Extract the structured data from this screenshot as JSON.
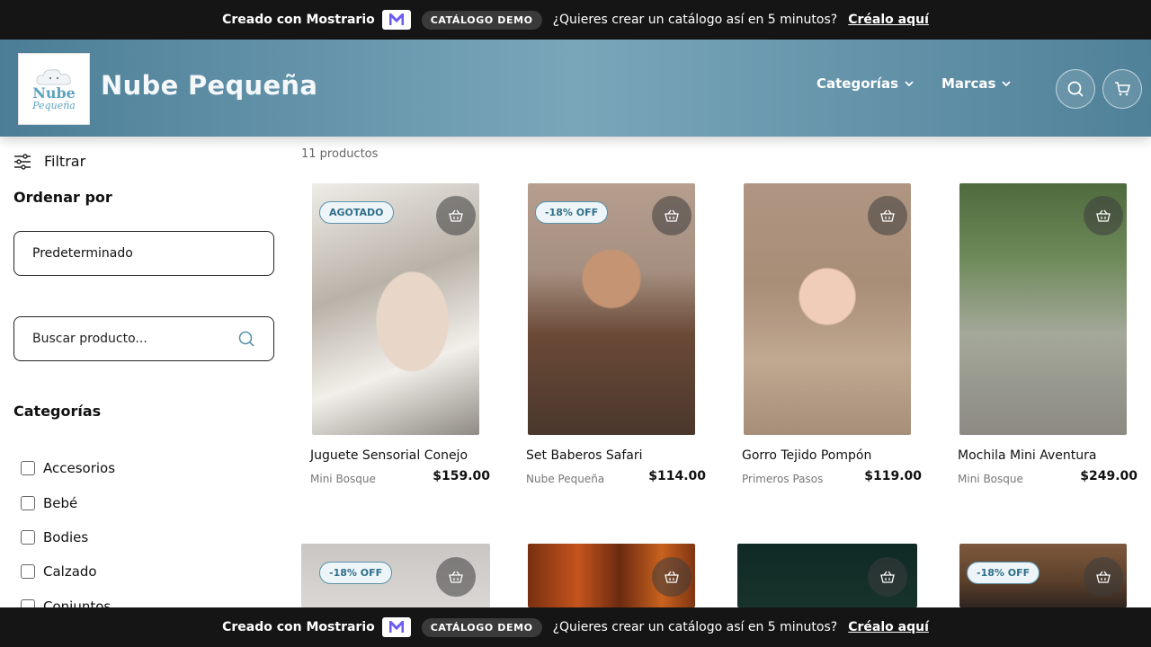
{
  "promo": {
    "created": "Creado con Mostrario",
    "demo_badge": "CATÁLOGO DEMO",
    "question": "¿Quieres crear un catálogo así en 5 minutos?",
    "cta": "Créalo aquí"
  },
  "header": {
    "logo_line1": "Nube",
    "logo_line2": "Pequeña",
    "brand_name": "Nube Pequeña",
    "nav": [
      "Categorías",
      "Marcas"
    ]
  },
  "sidebar": {
    "filter_label": "Filtrar",
    "sort_label": "Ordenar por",
    "sort_value": "Predeterminado",
    "search_placeholder": "Buscar producto...",
    "categories_title": "Categorías",
    "categories": [
      "Accesorios",
      "Bebé",
      "Bodies",
      "Calzado",
      "Conjuntos"
    ]
  },
  "catalog": {
    "count": "11 productos",
    "products": [
      {
        "name": "Juguete Sensorial Conejo",
        "brand": "Mini Bosque",
        "price": "$159.00",
        "badge": "AGOTADO"
      },
      {
        "name": "Set Baberos Safari",
        "brand": "Nube Pequeña",
        "price": "$114.00",
        "badge": "-18% OFF"
      },
      {
        "name": "Gorro Tejido Pompón",
        "brand": "Primeros Pasos",
        "price": "$119.00",
        "badge": ""
      },
      {
        "name": "Mochila Mini Aventura",
        "brand": "Mini Bosque",
        "price": "$249.00",
        "badge": ""
      },
      {
        "badge": "-18% OFF"
      },
      {
        "badge": ""
      },
      {
        "badge": ""
      },
      {
        "badge": "-18% OFF"
      }
    ]
  },
  "colors": {
    "header_start": "#4b7e96",
    "header_mid": "#7aa6ba",
    "badge_text": "#2f6f8b",
    "promo_bg": "#151515"
  }
}
